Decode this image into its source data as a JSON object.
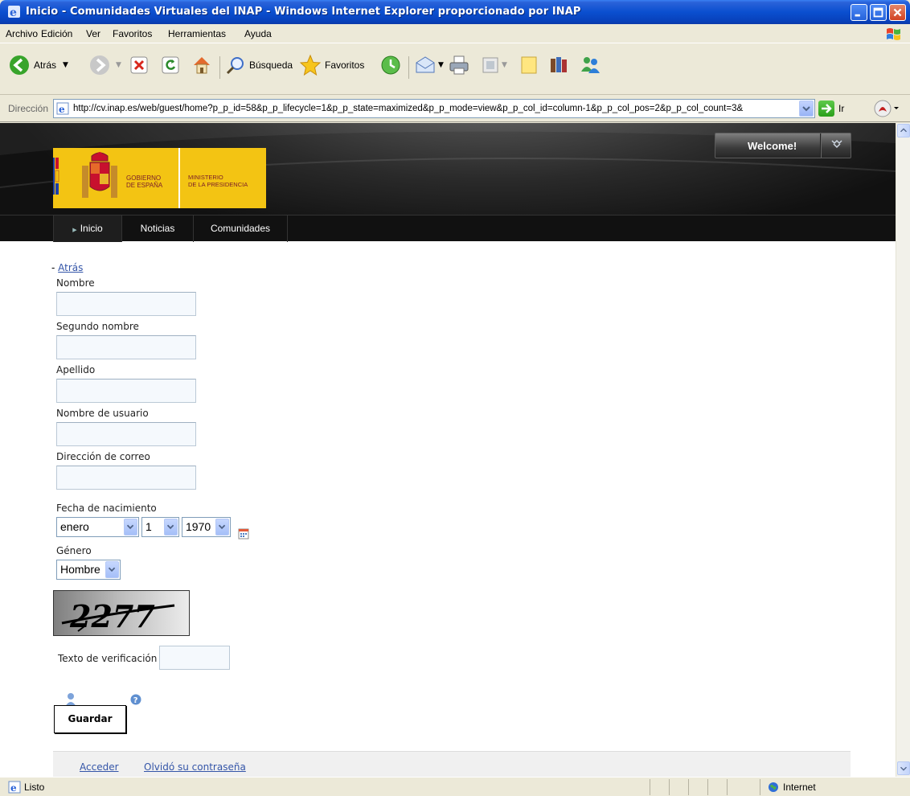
{
  "window": {
    "title": "Inicio - Comunidades Virtuales del INAP - Windows Internet Explorer proporcionado por INAP"
  },
  "menu": [
    "Archivo",
    "Edición",
    "Ver",
    "Favoritos",
    "Herramientas",
    "Ayuda"
  ],
  "toolbar": {
    "back_label": "Atrás",
    "search_label": "Búsqueda",
    "favorites_label": "Favoritos"
  },
  "address": {
    "label": "Dirección",
    "url": "http://cv.inap.es/web/guest/home?p_p_id=58&p_p_lifecycle=1&p_p_state=maximized&p_p_mode=view&p_p_col_id=column-1&p_p_col_pos=2&p_p_col_count=3&",
    "go_label": "Ir"
  },
  "site": {
    "logo_left": "GOBIERNO\nDE ESPAÑA",
    "logo_right": "MINISTERIO\nDE LA PRESIDENCIA",
    "welcome": "Welcome!",
    "nav": [
      "Inicio",
      "Noticias",
      "Comunidades"
    ]
  },
  "form": {
    "back_link": "Atrás",
    "fields": [
      "Nombre",
      "Segundo nombre",
      "Apellido",
      "Nombre de usuario",
      "Dirección de correo"
    ],
    "birthdate_label": "Fecha de nacimiento",
    "birth_month": "enero",
    "birth_day": "1",
    "birth_year": "1970",
    "gender_label": "Género",
    "gender": "Hombre",
    "captcha_text": "2277",
    "verification_label": "Texto de verificación",
    "save_label": "Guardar"
  },
  "footer": {
    "login": "Acceder",
    "forgot": "Olvidó su contraseña"
  },
  "status": {
    "text": "Listo",
    "zone": "Internet"
  }
}
